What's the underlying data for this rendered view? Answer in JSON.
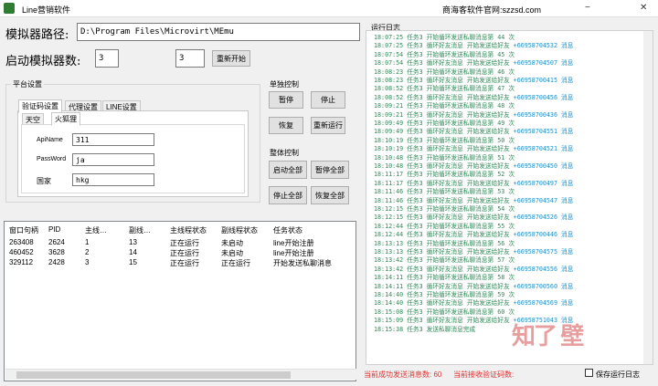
{
  "window": {
    "title": "Line营销软件",
    "site": "商海客软件官网:szzsd.com",
    "min": "−",
    "close": "✕"
  },
  "emulator": {
    "path_label": "模拟器路径:",
    "path_value": "D:\\Program Files\\Microvirt\\MEmu",
    "count_label": "启动模拟器数:",
    "count_value": "3",
    "restart_value": "3",
    "restart_button": "重新开始"
  },
  "platform": {
    "group_title": "平台设置",
    "tabs": [
      "验证码设置",
      "代理设置",
      "LINE设置"
    ],
    "subtabs": [
      "天空",
      "火狐狸"
    ],
    "fields": [
      {
        "label": "ApiName",
        "value": "311"
      },
      {
        "label": "PassWord",
        "value": "ja"
      },
      {
        "label": "国家",
        "value": "hkg"
      }
    ]
  },
  "single_control": {
    "title": "单独控制",
    "buttons": [
      "暂停",
      "停止",
      "恢复",
      "重新运行"
    ]
  },
  "global_control": {
    "title": "整体控制",
    "buttons": [
      "启动全部",
      "暂停全部",
      "停止全部",
      "恢复全部"
    ]
  },
  "table": {
    "headers": [
      "窗口句柄",
      "PID",
      "主线…",
      "副线…",
      "主线程状态",
      "副线程状态",
      "任务状态"
    ],
    "rows": [
      [
        "263408",
        "2624",
        "1",
        "13",
        "正在运行",
        "未启动",
        "line开始注册"
      ],
      [
        "460452",
        "3628",
        "2",
        "14",
        "正在运行",
        "未启动",
        "line开始注册"
      ],
      [
        "329112",
        "2428",
        "3",
        "15",
        "正在运行",
        "正在运行",
        "开始发送私聊消息"
      ]
    ]
  },
  "log": {
    "title": "运行日志",
    "lines": [
      {
        "time": "18:07:25",
        "text": "任务3 开始循环发送私聊消息第 44 次",
        "phone": ""
      },
      {
        "time": "18:07:25",
        "text": "任务3 循环好友消息 开始发送给好友",
        "phone": "+66958704532 消息"
      },
      {
        "time": "18:07:54",
        "text": "任务3 开始循环发送私聊消息第 45 次",
        "phone": ""
      },
      {
        "time": "18:07:54",
        "text": "任务3 循环好友消息 开始发送给好友",
        "phone": "+66958704507 消息"
      },
      {
        "time": "18:08:23",
        "text": "任务3 开始循环发送私聊消息第 46 次",
        "phone": ""
      },
      {
        "time": "18:08:23",
        "text": "任务3 循环好友消息 开始发送给好友",
        "phone": "+66958700415 消息"
      },
      {
        "time": "18:08:52",
        "text": "任务3 开始循环发送私聊消息第 47 次",
        "phone": ""
      },
      {
        "time": "18:08:52",
        "text": "任务3 循环好友消息 开始发送给好友",
        "phone": "+66958700456 消息"
      },
      {
        "time": "18:09:21",
        "text": "任务3 开始循环发送私聊消息第 48 次",
        "phone": ""
      },
      {
        "time": "18:09:21",
        "text": "任务3 循环好友消息 开始发送给好友",
        "phone": "+66958700436 消息"
      },
      {
        "time": "18:09:49",
        "text": "任务3 开始循环发送私聊消息第 49 次",
        "phone": ""
      },
      {
        "time": "18:09:49",
        "text": "任务3 循环好友消息 开始发送给好友",
        "phone": "+66958704551 消息"
      },
      {
        "time": "18:10:19",
        "text": "任务3 开始循环发送私聊消息第 50 次",
        "phone": ""
      },
      {
        "time": "18:10:19",
        "text": "任务3 循环好友消息 开始发送给好友",
        "phone": "+66958704521 消息"
      },
      {
        "time": "18:10:48",
        "text": "任务3 开始循环发送私聊消息第 51 次",
        "phone": ""
      },
      {
        "time": "18:10:48",
        "text": "任务3 循环好友消息 开始发送给好友",
        "phone": "+66958700450 消息"
      },
      {
        "time": "18:11:17",
        "text": "任务3 开始循环发送私聊消息第 52 次",
        "phone": ""
      },
      {
        "time": "18:11:17",
        "text": "任务3 循环好友消息 开始发送给好友",
        "phone": "+66958700497 消息"
      },
      {
        "time": "18:11:46",
        "text": "任务3 开始循环发送私聊消息第 53 次",
        "phone": ""
      },
      {
        "time": "18:11:46",
        "text": "任务3 循环好友消息 开始发送给好友",
        "phone": "+66958704547 消息"
      },
      {
        "time": "18:12:15",
        "text": "任务3 开始循环发送私聊消息第 54 次",
        "phone": ""
      },
      {
        "time": "18:12:15",
        "text": "任务3 循环好友消息 开始发送给好友",
        "phone": "+66958704526 消息"
      },
      {
        "time": "18:12:44",
        "text": "任务3 开始循环发送私聊消息第 55 次",
        "phone": ""
      },
      {
        "time": "18:12:44",
        "text": "任务3 循环好友消息 开始发送给好友",
        "phone": "+66958700446 消息"
      },
      {
        "time": "18:13:13",
        "text": "任务3 开始循环发送私聊消息第 56 次",
        "phone": ""
      },
      {
        "time": "18:13:13",
        "text": "任务3 循环好友消息 开始发送给好友",
        "phone": "+66958704575 消息"
      },
      {
        "time": "18:13:42",
        "text": "任务3 开始循环发送私聊消息第 57 次",
        "phone": ""
      },
      {
        "time": "18:13:42",
        "text": "任务3 循环好友消息 开始发送给好友",
        "phone": "+66958704556 消息"
      },
      {
        "time": "18:14:11",
        "text": "任务3 开始循环发送私聊消息第 58 次",
        "phone": ""
      },
      {
        "time": "18:14:11",
        "text": "任务3 循环好友消息 开始发送给好友",
        "phone": "+66958700560 消息"
      },
      {
        "time": "18:14:40",
        "text": "任务3 开始循环发送私聊消息第 59 次",
        "phone": ""
      },
      {
        "time": "18:14:40",
        "text": "任务3 循环好友消息 开始发送给好友",
        "phone": "+66958704569 消息"
      },
      {
        "time": "18:15:08",
        "text": "任务3 开始循环发送私聊消息第 60 次",
        "phone": ""
      },
      {
        "time": "18:15:09",
        "text": "任务3 循环好友消息 开始发送给好友",
        "phone": "+66958751043 消息"
      },
      {
        "time": "18:15:38",
        "text": "任务3 发送私聊消息完成",
        "phone": ""
      }
    ]
  },
  "status": {
    "sent": "当前成功发送消息数: 60",
    "code": "当前接收验证码数:",
    "save_log": "保存运行日志"
  },
  "watermark": "知了 壁"
}
